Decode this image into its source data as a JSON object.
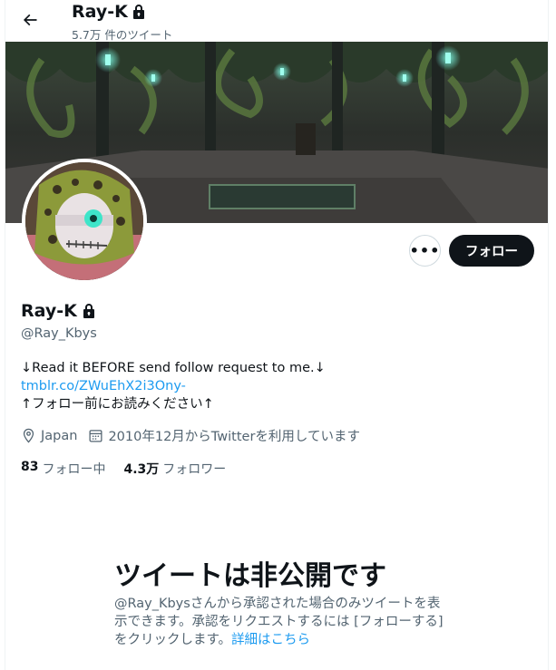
{
  "header": {
    "name": "Ray-K",
    "tweet_count": "5.7万 件のツイート"
  },
  "profile": {
    "name": "Ray-K",
    "handle": "@Ray_Kbys",
    "bio_line1": "↓Read it BEFORE send follow request to me.↓",
    "bio_link": "tmblr.co/ZWuEhX2i3Ony-",
    "bio_line3": "↑フォロー前にお読みください↑",
    "location": "Japan",
    "joined": "2010年12月からTwitterを利用しています",
    "following_count": "83",
    "following_label": "フォロー中",
    "followers_count": "4.3万",
    "followers_label": "フォロワー"
  },
  "actions": {
    "more": "•••",
    "follow": "フォロー"
  },
  "private_notice": {
    "title": "ツイートは非公開です",
    "desc": "@Ray_Kbysさんから承認された場合のみツイートを表示できます。承認をリクエストするには [フォローする] をクリックします。",
    "link": "詳細はこちら"
  },
  "icons": [
    "back-arrow-icon",
    "lock-icon",
    "location-pin-icon",
    "calendar-icon"
  ],
  "colors": {
    "accent": "#1d9bf0",
    "text": "#0f1419",
    "secondary": "#536471"
  }
}
